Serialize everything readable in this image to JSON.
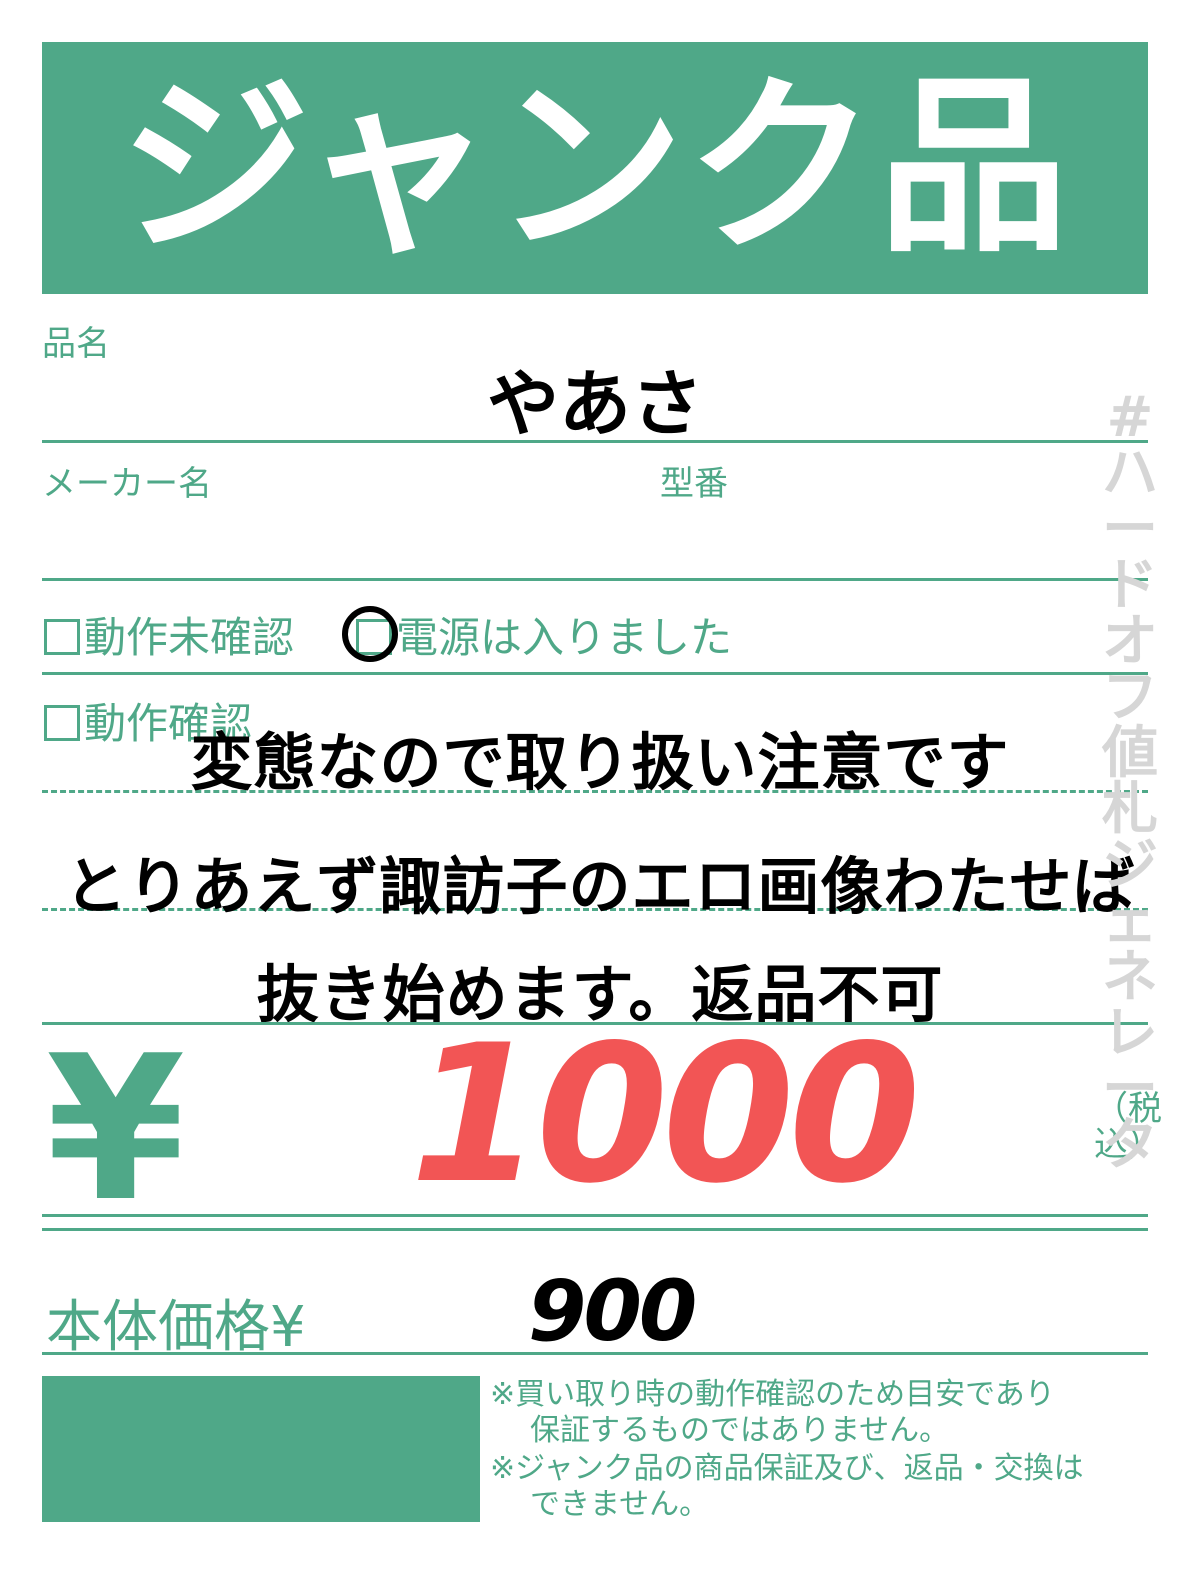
{
  "title": "ジャンク品",
  "fields": {
    "product_name_label": "品名",
    "product_name_value": "やあさ",
    "maker_label": "メーカー名",
    "model_label": "型番"
  },
  "checks": {
    "unverified_label": "動作未確認",
    "power_on_label": "電源は入りました",
    "verified_label": "動作確認"
  },
  "notes": [
    "変態なので取り扱い注意です",
    "とりあえず諏訪子のエロ画像わたせば",
    "抜き始めます。返品不可"
  ],
  "price": {
    "currency": "¥",
    "value": "1000",
    "tax_note": "（税込）",
    "body_label": "本体価格¥",
    "body_value": "900"
  },
  "disclaimers": [
    "※買い取り時の動作確認のため目安であり",
    "保証するものではありません。",
    "※ジャンク品の商品保証及び、返品・交換は",
    "できません。"
  ],
  "watermark": "#ハードオフ値札ジェネレータ",
  "colors": {
    "accent": "#4fa888",
    "price": "#f25555",
    "watermark": "#d6d6d6"
  }
}
